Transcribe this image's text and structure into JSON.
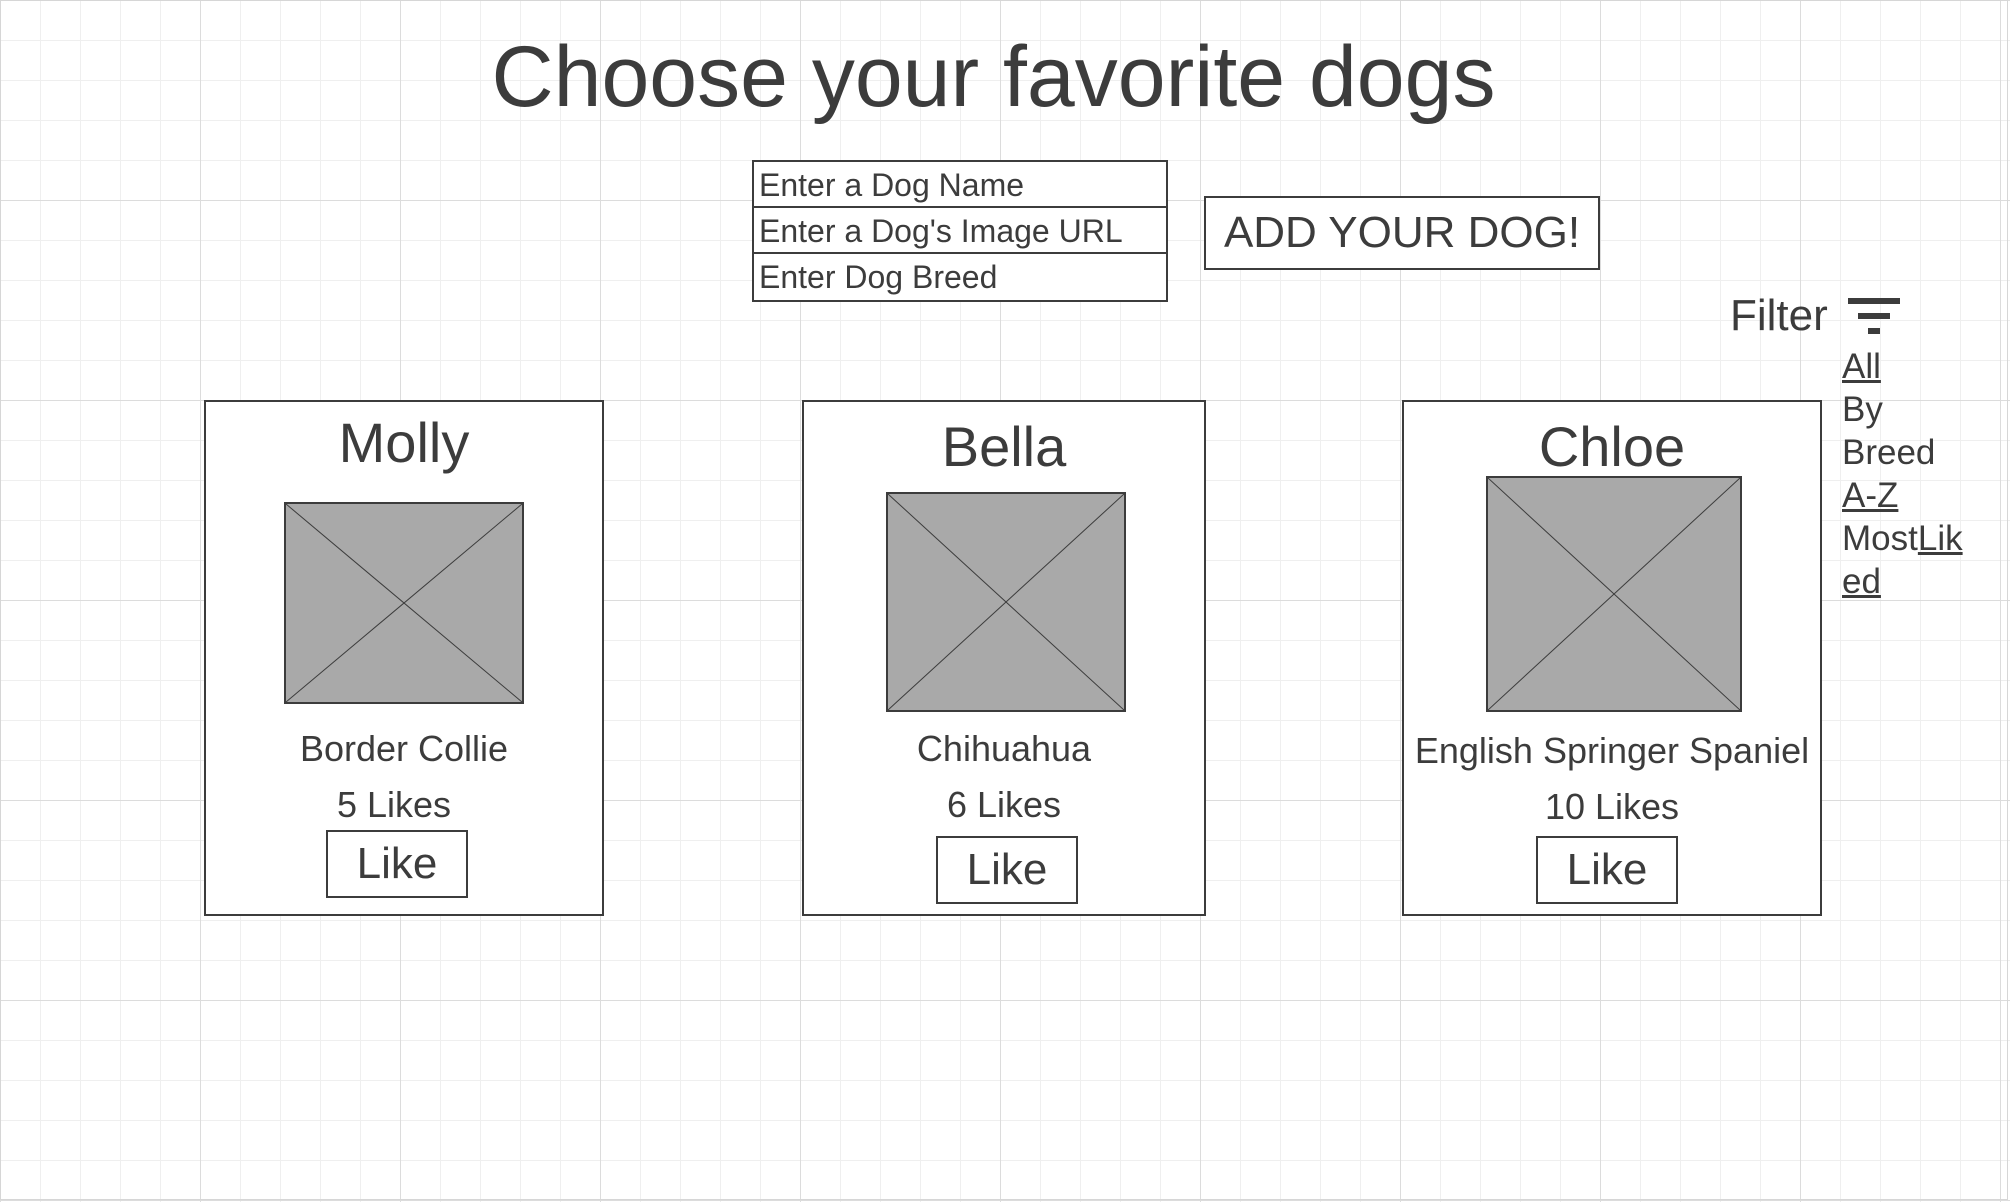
{
  "header": {
    "title": "Choose your favorite dogs"
  },
  "form": {
    "name_placeholder": "Enter a Dog Name",
    "image_placeholder": "Enter a Dog's Image URL",
    "breed_placeholder": "Enter Dog Breed",
    "submit_label": "ADD YOUR DOG!"
  },
  "filter": {
    "label": "Filter",
    "icon": "filter-icon",
    "options": {
      "all": "All",
      "by": "By",
      "breed": "Breed",
      "az": "A-Z",
      "most": "Most",
      "lik": "Lik",
      "ed": "ed"
    }
  },
  "dogs": [
    {
      "name": "Molly",
      "breed": "Border Collie",
      "likes": "5 Likes",
      "like_label": "Like"
    },
    {
      "name": "Bella",
      "breed": "Chihuahua",
      "likes": "6 Likes",
      "like_label": "Like"
    },
    {
      "name": "Chloe",
      "breed": "English Springer Spaniel",
      "likes": "10 Likes",
      "like_label": "Like"
    }
  ]
}
